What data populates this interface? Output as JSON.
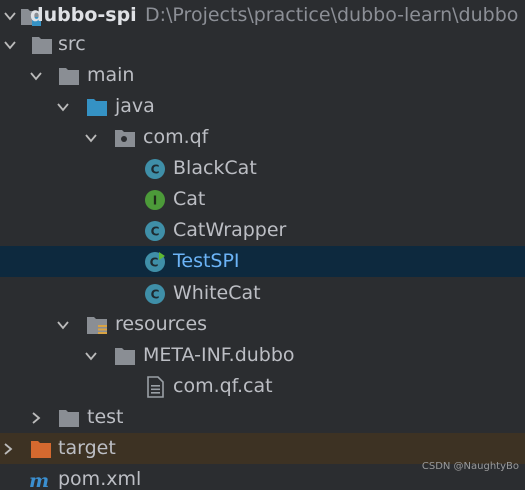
{
  "project": {
    "name": "dubbo-spi",
    "path": "D:\\Projects\\practice\\dubbo-learn\\dubbo"
  },
  "tree": {
    "src": "src",
    "main": "main",
    "java": "java",
    "package": "com.qf",
    "classes": {
      "blackcat": "BlackCat",
      "cat": "Cat",
      "catwrapper": "CatWrapper",
      "testspi": "TestSPI",
      "whitecat": "WhiteCat"
    },
    "resources": "resources",
    "metainf": "META-INF.dubbo",
    "spi_file": "com.qf.cat",
    "test": "test",
    "target": "target",
    "pom": "pom.xml"
  },
  "class_icon_letters": {
    "class": "C",
    "interface": "I"
  },
  "colors": {
    "background": "#2b2d30",
    "selected_row": "#0d293e",
    "target_row": "#3d3223",
    "folder": "#8a8e94",
    "source_folder": "#3592c4",
    "excluded_folder": "#d4692f",
    "class_icon": "#3f8fa8",
    "interface_icon": "#4c9a39",
    "selected_text": "#6cb4f7"
  },
  "watermark": "CSDN @NaughtyBo"
}
